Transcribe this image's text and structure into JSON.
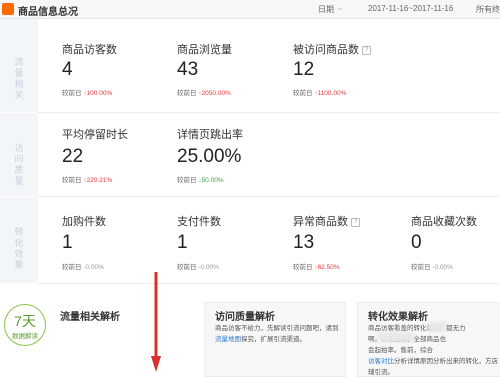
{
  "header": {
    "title": "商品信息总况",
    "date_label": "日期",
    "date_range": "2017-11-16~2017-11-16",
    "terminal": "所有终端"
  },
  "sections": {
    "traffic": "流量相关",
    "quality": "访问质量",
    "conversion": "转化效果"
  },
  "metrics": {
    "visitors": {
      "label": "商品访客数",
      "value": "4",
      "cmp_label": "较前日",
      "change": "100.00%"
    },
    "pageviews": {
      "label": "商品浏览量",
      "value": "43",
      "cmp_label": "较前日",
      "change": "2050.00%"
    },
    "visited": {
      "label": "被访问商品数",
      "help": "?",
      "value": "12",
      "cmp_label": "较前日",
      "change": "1100.00%"
    },
    "avg_stay": {
      "label": "平均停留时长",
      "value": "22",
      "cmp_label": "较前日",
      "change": "220.21%"
    },
    "bounce": {
      "label": "详情页跳出率",
      "value": "25.00%",
      "cmp_label": "较前日",
      "change": "50.00%"
    },
    "cart_add": {
      "label": "加购件数",
      "value": "1",
      "cmp_label": "较前日",
      "change": "0.00%"
    },
    "paid": {
      "label": "支付件数",
      "value": "1",
      "cmp_label": "较前日",
      "change": "0.00%"
    },
    "abnormal": {
      "label": "异常商品数",
      "help": "?",
      "value": "13",
      "cmp_label": "较前日",
      "change": "62.50%"
    },
    "favorites": {
      "label": "商品收藏次数",
      "value": "0",
      "cmp_label": "较前日",
      "change": "0.00%"
    }
  },
  "analysis": {
    "badge_days": "7天",
    "badge_text": "数据解读",
    "traffic_title": "流量相关解析",
    "quality_title": "访问质量解析",
    "quality_text_1": "商品访客不给力，先解读引流问题吧，请到",
    "quality_link_1": "流",
    "quality_link_2": "量地图",
    "quality_text_2": "探究，扩展引流渠道。",
    "conversion_title": "转化效果解析",
    "conversion_text_1": "商品访客看盖",
    "conversion_text_2": "的转化效果，都无力",
    "conversion_text_3": "啊。",
    "conversion_text_4": "转化也高，全部商品也",
    "conversion_text_5": "会起拍",
    "conversion_text_6": "率。",
    "conversion_text_7": "售前，综合",
    "conversion_link": "访客对比",
    "conversion_text_8": "分析详情原因分析出来的转化，方店",
    "conversion_text_9": "辅引流。"
  },
  "colors": {
    "up": "#e4393c",
    "down": "#3ea34a",
    "accent": "#ff6a00",
    "annotation_arrow": "#d9302c"
  }
}
